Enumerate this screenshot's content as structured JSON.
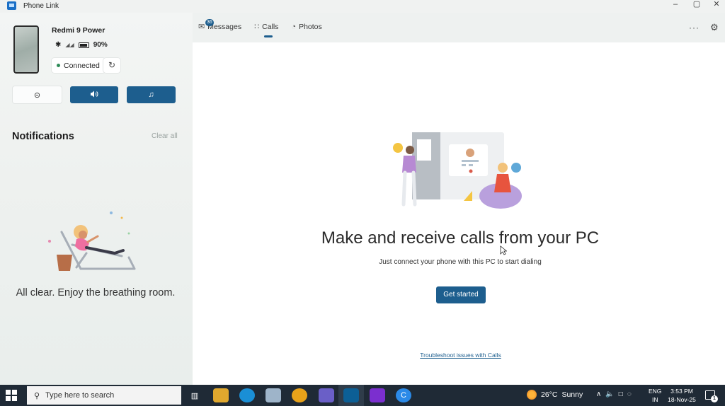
{
  "window": {
    "title": "Phone Link",
    "controls": {
      "minimize": "–",
      "restore": "▢",
      "close": "✕"
    }
  },
  "device": {
    "name": "Redmi 9 Power",
    "battery": "90%",
    "battery_level": 0.9,
    "status": "Connected"
  },
  "quick_actions": [
    {
      "name": "do-not-disturb-button",
      "icon": "minus-circle-icon",
      "glyph": "⊝"
    },
    {
      "name": "volume-button",
      "icon": "speaker-icon",
      "glyph": "🔈"
    },
    {
      "name": "media-button",
      "icon": "music-note-icon",
      "glyph": "♫"
    }
  ],
  "notifications": {
    "title": "Notifications",
    "clear_all": "Clear all",
    "empty_message": "All clear. Enjoy the breathing room."
  },
  "tabs": [
    {
      "label": "Messages",
      "badge": "36",
      "active": false
    },
    {
      "label": "Calls",
      "active": true
    },
    {
      "label": "Photos",
      "active": false
    }
  ],
  "toolbar": {
    "more": "···",
    "settings": "⚙"
  },
  "calls": {
    "headline": "Make and receive calls from your PC",
    "subtext": "Just connect your phone with this PC to start dialing",
    "button": "Get started",
    "troubleshoot": "Troubleshoot issues with Calls"
  },
  "taskbar": {
    "search_placeholder": "Type here to search",
    "weather": {
      "temp": "26°C",
      "condition": "Sunny"
    },
    "language": {
      "line1": "ENG",
      "line2": "IN"
    },
    "clock": {
      "time": "3:53 PM",
      "date": "18-Nov-25"
    },
    "notification_count": "1",
    "accent_colors": {
      "edge": "#1a8fd6",
      "chrome": "#e8a21a",
      "phonelink": "#0c5f95",
      "clipchamp": "#7b2fcf",
      "c_app": "#2b8ae8"
    }
  },
  "colors": {
    "accent": "#1d5e8e",
    "connected_dot": "#2e8b57"
  }
}
